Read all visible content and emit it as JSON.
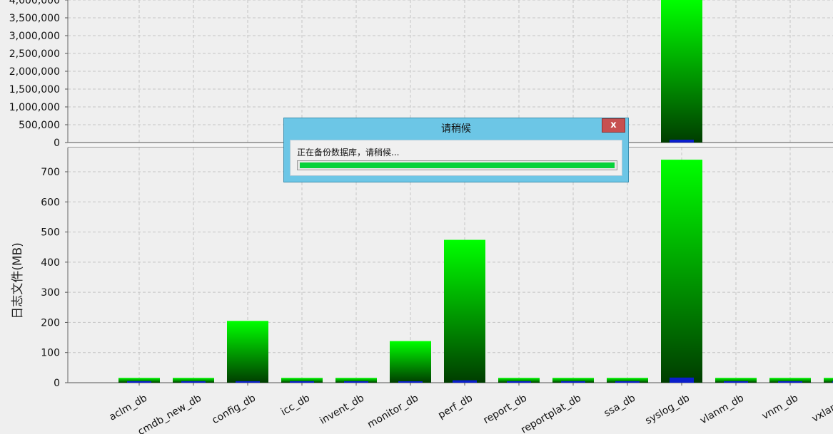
{
  "dialog": {
    "title": "请稍候",
    "close_label": "x",
    "message": "正在备份数据库，请稍候...",
    "progress": 1.0
  },
  "colors": {
    "bar_top": "#00ff00",
    "bar_bottom": "#003d00",
    "inner_bar": "#0a1ecc",
    "dialog_bg": "#6cc6e6",
    "close_bg": "#c75050",
    "progress_fill": "#06d23a"
  },
  "chart_data": [
    {
      "type": "bar",
      "title": "",
      "xlabel": "",
      "ylabel": "",
      "ylim": [
        0,
        4000000
      ],
      "yticks": [
        0,
        500000,
        1000000,
        1500000,
        2000000,
        2500000,
        3000000,
        3500000,
        4000000
      ],
      "ytick_labels": [
        "0",
        "500,000",
        "1,000,000",
        "1,500,000",
        "2,000,000",
        "2,500,000",
        "3,000,000",
        "3,500,000",
        "4,000,000"
      ],
      "categories": [
        "aclm_db",
        "cmdb_new_db",
        "config_db",
        "icc_db",
        "invent_db",
        "monitor_db",
        "perf_db",
        "report_db",
        "reportplat_db",
        "ssa_db",
        "syslog_db",
        "vlanm_db",
        "vnm_db",
        "vxlan_db"
      ],
      "values": [
        0,
        0,
        0,
        0,
        0,
        0,
        0,
        0,
        0,
        0,
        4100000,
        0,
        0,
        0
      ],
      "inner_values": [
        0,
        0,
        0,
        0,
        0,
        0,
        0,
        0,
        0,
        0,
        80000,
        0,
        0,
        0
      ],
      "grid": true
    },
    {
      "type": "bar",
      "title": "",
      "xlabel": "",
      "ylabel": "日志文件(MB)",
      "ylim": [
        0,
        750
      ],
      "yticks": [
        0,
        100,
        200,
        300,
        400,
        500,
        600,
        700
      ],
      "ytick_labels": [
        "0",
        "100",
        "200",
        "300",
        "400",
        "500",
        "600",
        "700"
      ],
      "categories": [
        "aclm_db",
        "cmdb_new_db",
        "config_db",
        "icc_db",
        "invent_db",
        "monitor_db",
        "perf_db",
        "report_db",
        "reportplat_db",
        "ssa_db",
        "syslog_db",
        "vlanm_db",
        "vnm_db",
        "vxlan_db"
      ],
      "values": [
        16,
        16,
        205,
        16,
        16,
        138,
        474,
        16,
        16,
        16,
        740,
        16,
        16,
        16
      ],
      "inner_values": [
        5,
        4,
        5,
        4,
        4,
        4,
        8,
        4,
        4,
        4,
        17,
        4,
        4,
        4
      ],
      "grid": true
    }
  ]
}
